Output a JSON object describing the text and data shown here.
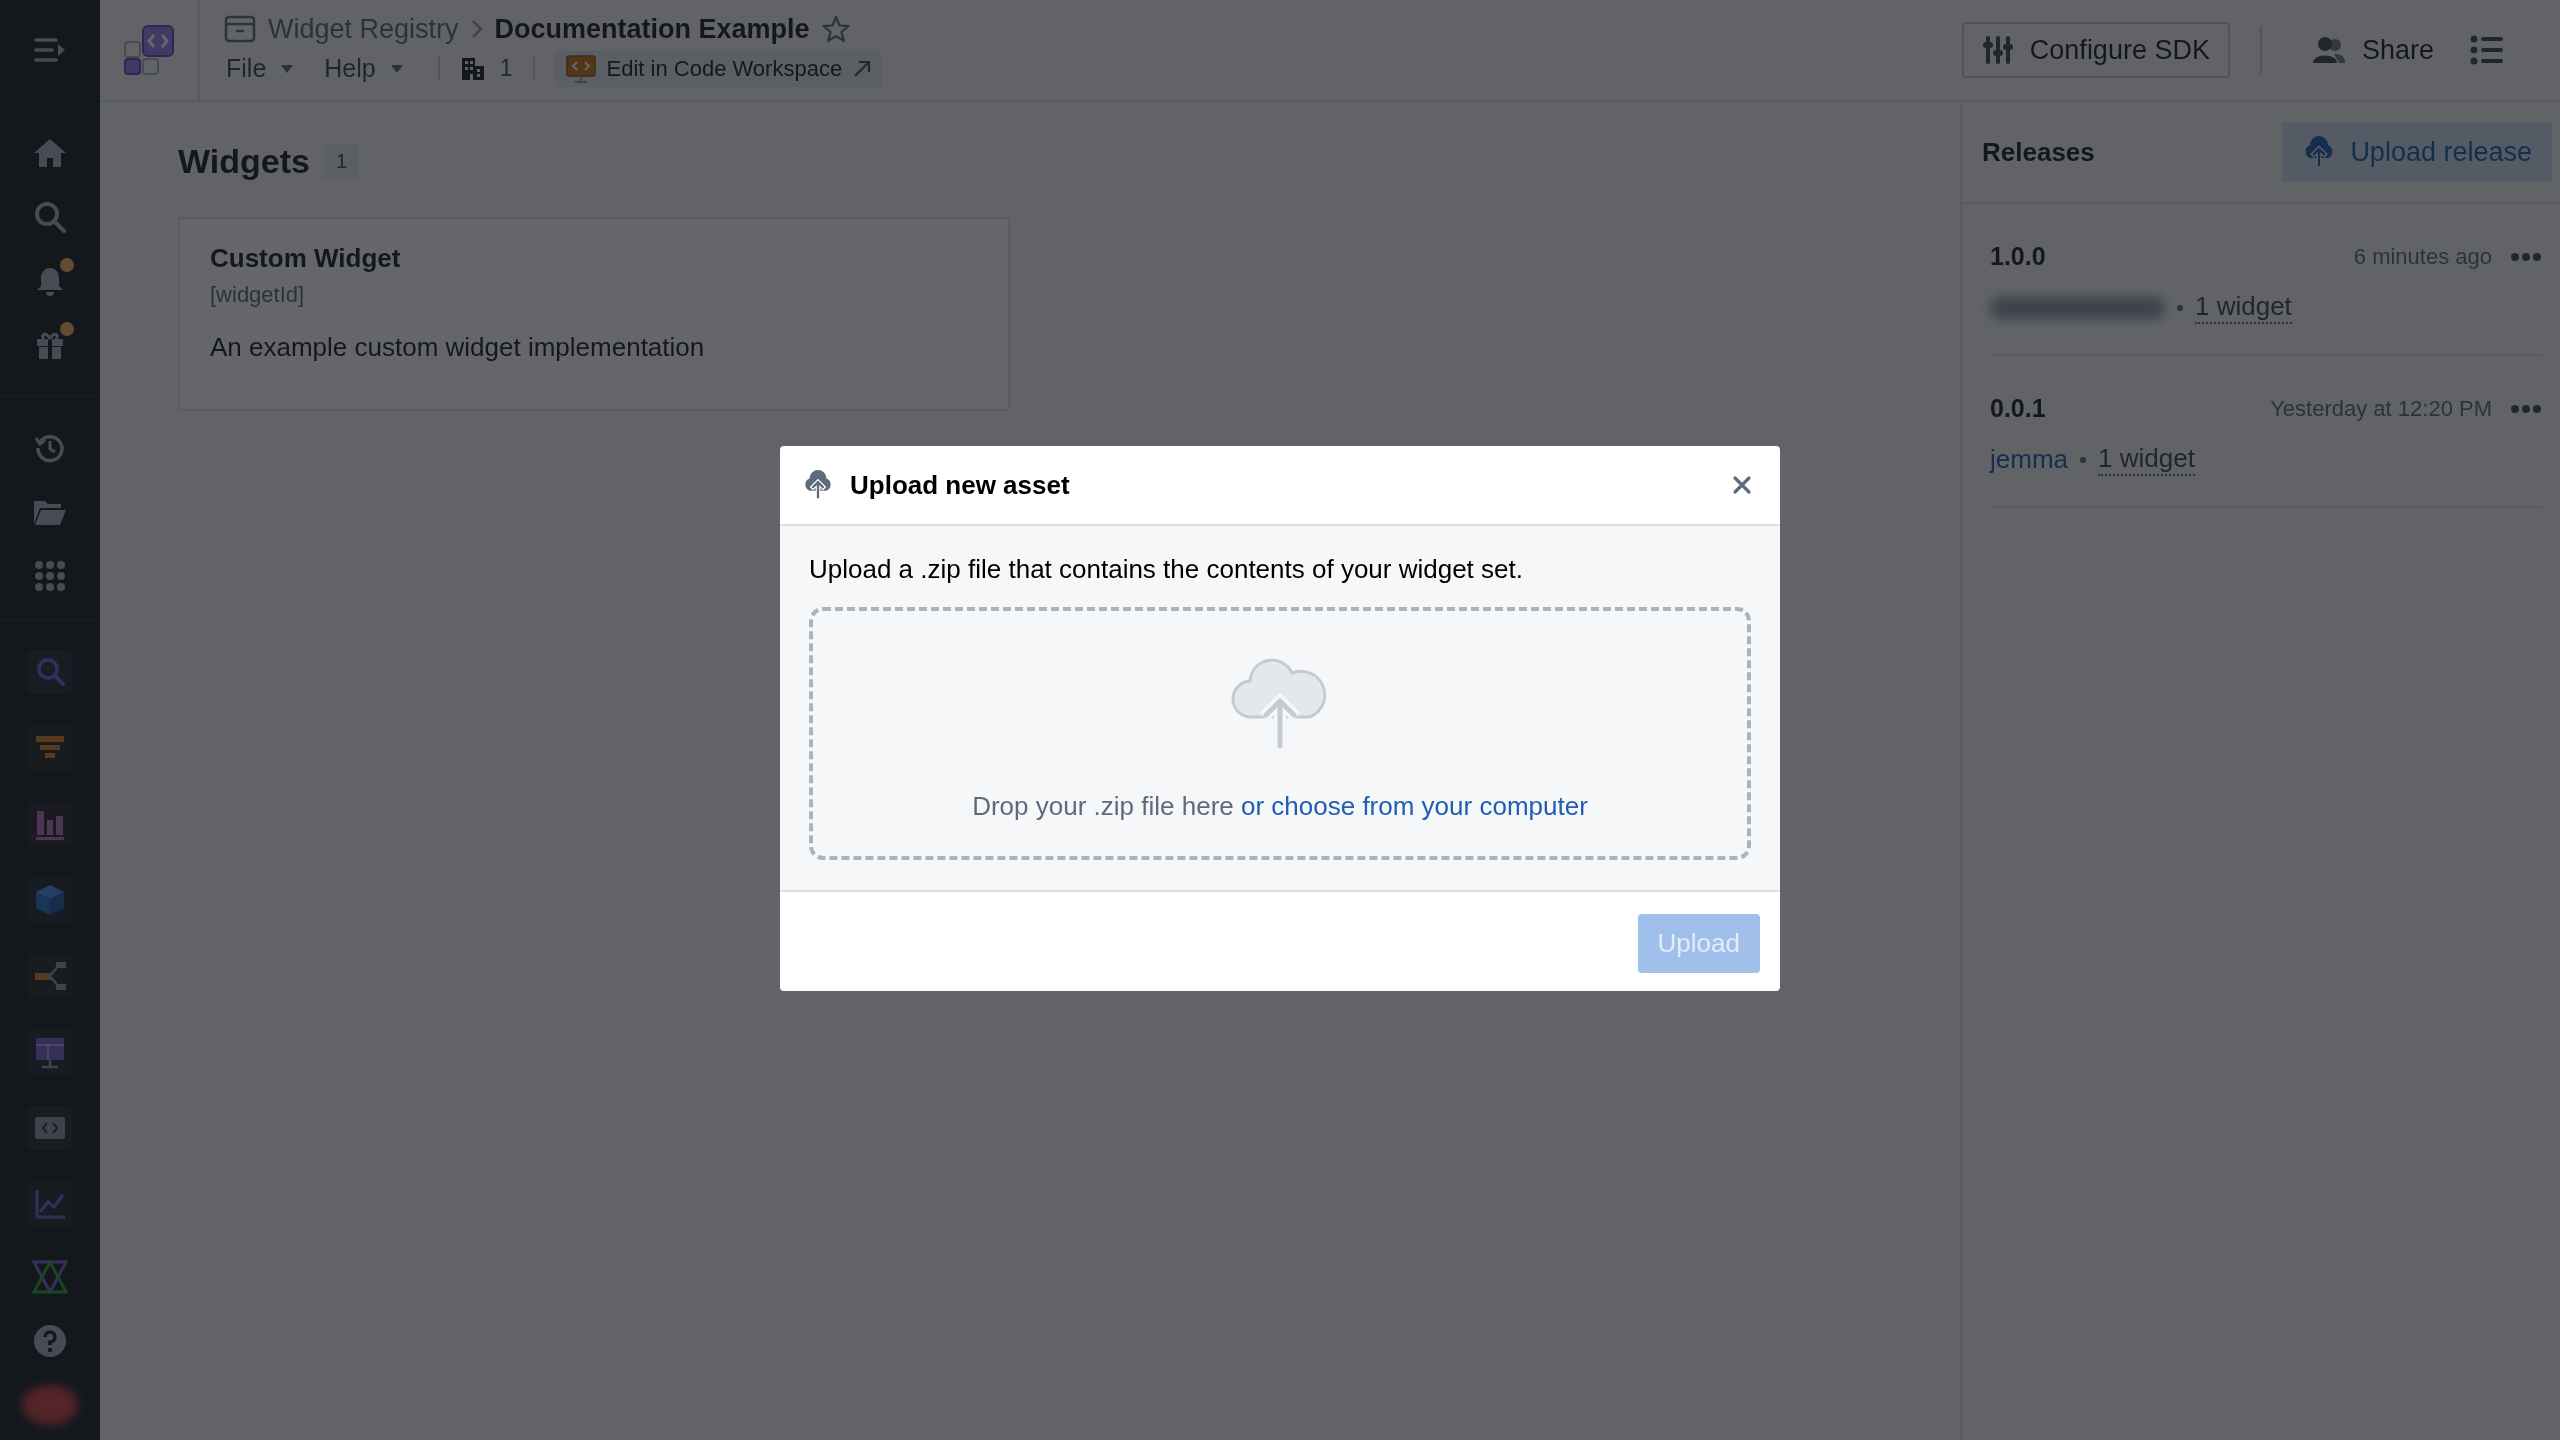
{
  "sidebar": {
    "items": [
      {
        "kind": "home",
        "notification": false
      },
      {
        "kind": "search",
        "notification": false
      },
      {
        "kind": "bell",
        "notification": true
      },
      {
        "kind": "gift",
        "notification": true
      },
      {
        "kind": "history",
        "notification": false
      },
      {
        "kind": "folder",
        "notification": false
      },
      {
        "kind": "grid",
        "notification": false
      }
    ],
    "apps": [
      {
        "kind": "search"
      },
      {
        "kind": "funnel"
      },
      {
        "kind": "bars"
      },
      {
        "kind": "cube"
      },
      {
        "kind": "branch"
      },
      {
        "kind": "table"
      },
      {
        "kind": "code"
      },
      {
        "kind": "line"
      }
    ],
    "footer": [
      {
        "kind": "logo"
      },
      {
        "kind": "help"
      },
      {
        "kind": "avatar"
      }
    ]
  },
  "header": {
    "breadcrumb": "Widget Registry",
    "title": "Documentation Example",
    "starred": false,
    "menus": [
      "File",
      "Help"
    ],
    "org_count": "1",
    "workspace_button": "Edit in Code Workspace",
    "configure_button": "Configure SDK",
    "share_button": "Share"
  },
  "widgets": {
    "title": "Widgets",
    "count": "1",
    "cards": [
      {
        "name": "Custom Widget",
        "id": "[widgetId]",
        "description": "An example custom widget implementation"
      }
    ]
  },
  "releases": {
    "title": "Releases",
    "upload_button": "Upload release",
    "items": [
      {
        "version": "1.0.0",
        "time": "6 minutes ago",
        "widgets": "1 widget"
      },
      {
        "version": "0.0.1",
        "time": "Yesterday at 12:20 PM",
        "author": "jemma",
        "widgets": "1 widget"
      }
    ]
  },
  "dialog": {
    "title": "Upload new asset",
    "description": "Upload a .zip file that contains the contents of your widget set.",
    "drop_text": "Drop your .zip file here",
    "drop_link": "or choose from your computer",
    "upload_button": {
      "label": "Upload",
      "disabled": true
    }
  }
}
